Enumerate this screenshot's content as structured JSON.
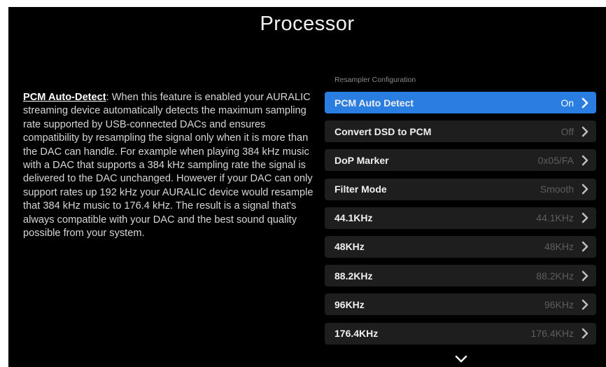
{
  "page": {
    "title": "Processor"
  },
  "description": {
    "term": "PCM Auto-Detect",
    "text": ": When this feature is enabled your AURALIC streaming device automatically detects the maximum sampling rate supported by USB-connected DACs and ensures compatibility by resampling the signal only when it is more than the DAC can handle. For example when playing 384 kHz music with a DAC that supports a 384 kHz sampling rate the signal is delivered to the DAC unchanged. However if your DAC can only support rates up 192 kHz your AURALIC device would resample that 384 kHz music to 176.4 kHz. The result is a signal that's always compatible with your DAC and the best sound quality possible from your system."
  },
  "menu": {
    "section_label": "Resampler Configuration",
    "items": [
      {
        "label": "PCM Auto Detect",
        "value": "On",
        "selected": true
      },
      {
        "label": "Convert DSD to PCM",
        "value": "Off"
      },
      {
        "label": "DoP Marker",
        "value": "0x05/FA"
      },
      {
        "label": "Filter Mode",
        "value": "Smooth"
      },
      {
        "label": "44.1KHz",
        "value": "44.1KHz"
      },
      {
        "label": "48KHz",
        "value": "48KHz"
      },
      {
        "label": "88.2KHz",
        "value": "88.2KHz"
      },
      {
        "label": "96KHz",
        "value": "96KHz"
      },
      {
        "label": "176.4KHz",
        "value": "176.4KHz"
      }
    ]
  },
  "icons": {
    "row_chevron": "chevron-right-icon",
    "scroll_indicator": "chevron-down-icon"
  },
  "colors": {
    "background": "#000000",
    "selected_row": "#2a7de1",
    "row": "#1e1e1e",
    "muted_value": "#5e5e5e"
  }
}
